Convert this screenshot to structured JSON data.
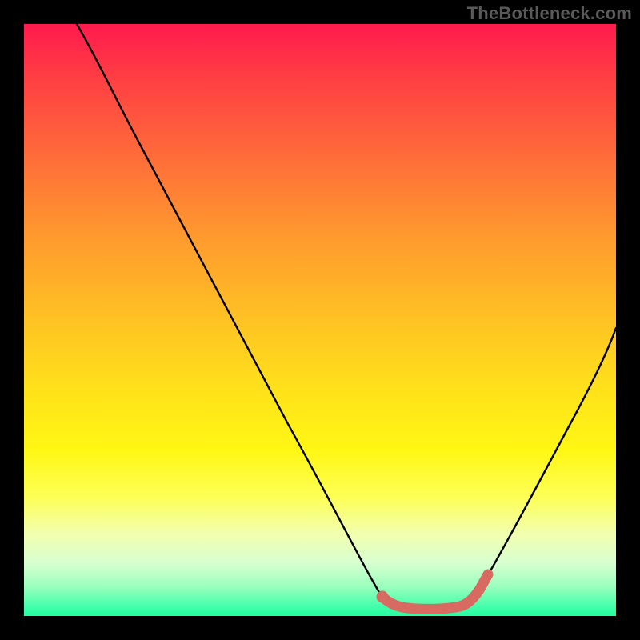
{
  "watermark": "TheBottleneck.com",
  "chart_data": {
    "type": "line",
    "title": "",
    "xlabel": "",
    "ylabel": "",
    "xlim": [
      0,
      100
    ],
    "ylim": [
      0,
      100
    ],
    "grid": false,
    "legend": false,
    "series": [
      {
        "name": "bottleneck-curve",
        "color": "#000000",
        "x": [
          9,
          15,
          22,
          30,
          38,
          46,
          54,
          58,
          60,
          62,
          66,
          72,
          75,
          78,
          84,
          90,
          96,
          100
        ],
        "y": [
          100,
          92,
          82,
          70,
          58,
          45,
          30,
          16,
          7,
          2,
          1,
          1,
          2,
          4,
          15,
          30,
          46,
          58
        ]
      },
      {
        "name": "optimal-range-marker",
        "color": "#d96a62",
        "x": [
          60,
          62,
          66,
          70,
          74,
          75,
          76
        ],
        "y": [
          3.5,
          2,
          1.5,
          1.5,
          2,
          4,
          6.5
        ]
      }
    ],
    "markers": [
      {
        "name": "optimal-start-dot",
        "x": 60,
        "y": 3.5,
        "color": "#d96a62"
      }
    ],
    "background_gradient": {
      "stops": [
        {
          "pos": 0,
          "color": "#ff1a4e"
        },
        {
          "pos": 22,
          "color": "#ff6b3a"
        },
        {
          "pos": 50,
          "color": "#ffc223"
        },
        {
          "pos": 72,
          "color": "#fff714"
        },
        {
          "pos": 91,
          "color": "#d8ffd0"
        },
        {
          "pos": 100,
          "color": "#1fffa3"
        }
      ]
    }
  }
}
